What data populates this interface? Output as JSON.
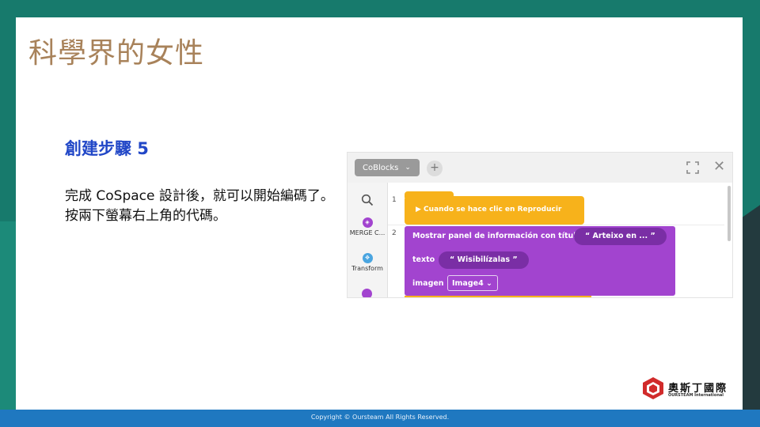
{
  "slide": {
    "title": "科學界的女性",
    "step_title": "創建步驟 5",
    "step_body": "完成 CoSpace 設計後，就可以開始編碼了。按兩下螢幕右上角的代碼。",
    "footer": "Copyright © Oursteam All Rights Reserved.",
    "logo_name": "奧斯丁國際",
    "logo_sub": "OURSTEAM International"
  },
  "editor": {
    "tab_label": "CoBlocks",
    "tab_chevron": "⌄",
    "add_tab": "+",
    "close": "✕",
    "sidebar": [
      {
        "label": "MERGE C...",
        "icon": "merge-cube-icon",
        "color": "#a244cf",
        "glyph": "◈"
      },
      {
        "label": "Transform",
        "icon": "transform-icon",
        "color": "#4aa5e0",
        "glyph": "✥"
      }
    ],
    "line_numbers": [
      "1",
      "2"
    ],
    "event_block": "▶ Cuando se hace clic en Reproducir",
    "panel_block": {
      "label": "Mostrar panel de información con título",
      "title_value": "“ Arteixo en ... ”",
      "text_label": "texto",
      "text_value": "“ Wisibilízalas ”",
      "image_label": "imagen",
      "image_value": "Image4 ⌄"
    }
  },
  "colors": {
    "title": "#a8825a",
    "step_title": "#2147c7",
    "event_block": "#f7b21b",
    "purple_block": "#a244cf",
    "footer_bar": "#1f78c0"
  }
}
